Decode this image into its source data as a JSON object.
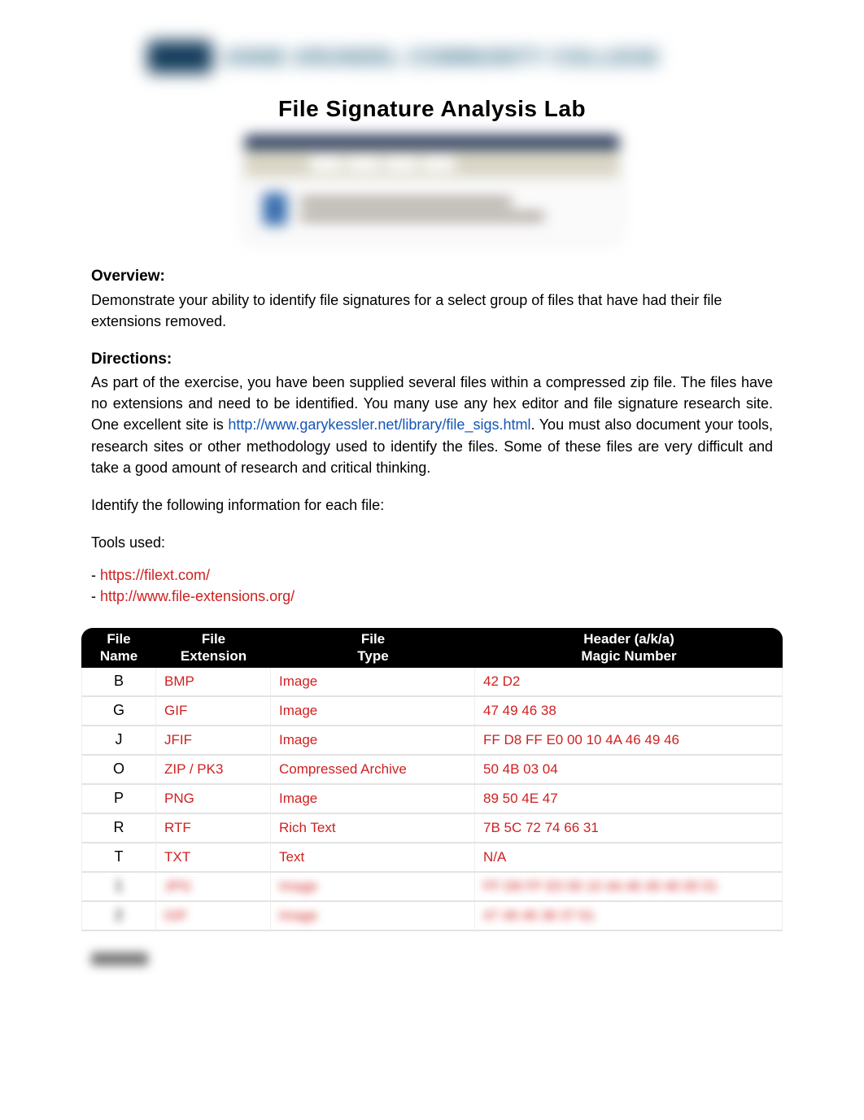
{
  "banner": {
    "org_text": "ANNE ARUNDEL COMMUNITY COLLEGE"
  },
  "title": "File Signature Analysis Lab",
  "overview": {
    "heading": "Overview:",
    "text": "Demonstrate your ability to identify file signatures for a select group of files that have had their file extensions removed."
  },
  "directions": {
    "heading": "Directions:",
    "text_before_link": "As part of the exercise, you have been supplied several files within a compressed zip file.  The files have no extensions and need to be identified. You many use any hex editor and file signature research site. One excellent site is ",
    "link_text": "http://www.garykessler.net/library/file_sigs.html",
    "text_after_link": ". You must also document your tools, research sites or other methodology used to identify the files. Some of these files are very difficult and take a good amount of research and critical thinking."
  },
  "identify_line": "Identify the following information for each file:",
  "tools_heading": "Tools used:",
  "tools": [
    "https://filext.com/",
    "http://www.file-extensions.org/"
  ],
  "table": {
    "headers": {
      "name_l1": "File",
      "name_l2": "Name",
      "ext_l1": "File",
      "ext_l2": "Extension",
      "type_l1": "File",
      "type_l2": "Type",
      "magic_l1": "Header (a/k/a)",
      "magic_l2": "Magic Number"
    },
    "rows": [
      {
        "name": "B",
        "ext": "BMP",
        "type": "Image",
        "magic": "42 D2",
        "blurred": false
      },
      {
        "name": "G",
        "ext": "GIF",
        "type": "Image",
        "magic": "47 49 46 38",
        "blurred": false
      },
      {
        "name": "J",
        "ext": "JFIF",
        "type": "Image",
        "magic": "FF D8 FF E0 00 10 4A 46 49 46",
        "blurred": false
      },
      {
        "name": "O",
        "ext": "ZIP / PK3",
        "type": "Compressed Archive",
        "magic": "50 4B 03 04",
        "blurred": false
      },
      {
        "name": "P",
        "ext": "PNG",
        "type": "Image",
        "magic": "89 50 4E 47",
        "blurred": false
      },
      {
        "name": "R",
        "ext": "RTF",
        "type": "Rich Text",
        "magic": "7B 5C 72 74 66 31",
        "blurred": false
      },
      {
        "name": "T",
        "ext": "TXT",
        "type": "Text",
        "magic": "N/A",
        "blurred": false
      },
      {
        "name": "1",
        "ext": "JPG",
        "type": "Image",
        "magic": "FF D8 FF E0 00 10 4A 46 49 46 00 01",
        "blurred": true
      },
      {
        "name": "2",
        "ext": "GIF",
        "type": "Image",
        "magic": "47 49 46 38 37 61",
        "blurred": true
      }
    ]
  }
}
